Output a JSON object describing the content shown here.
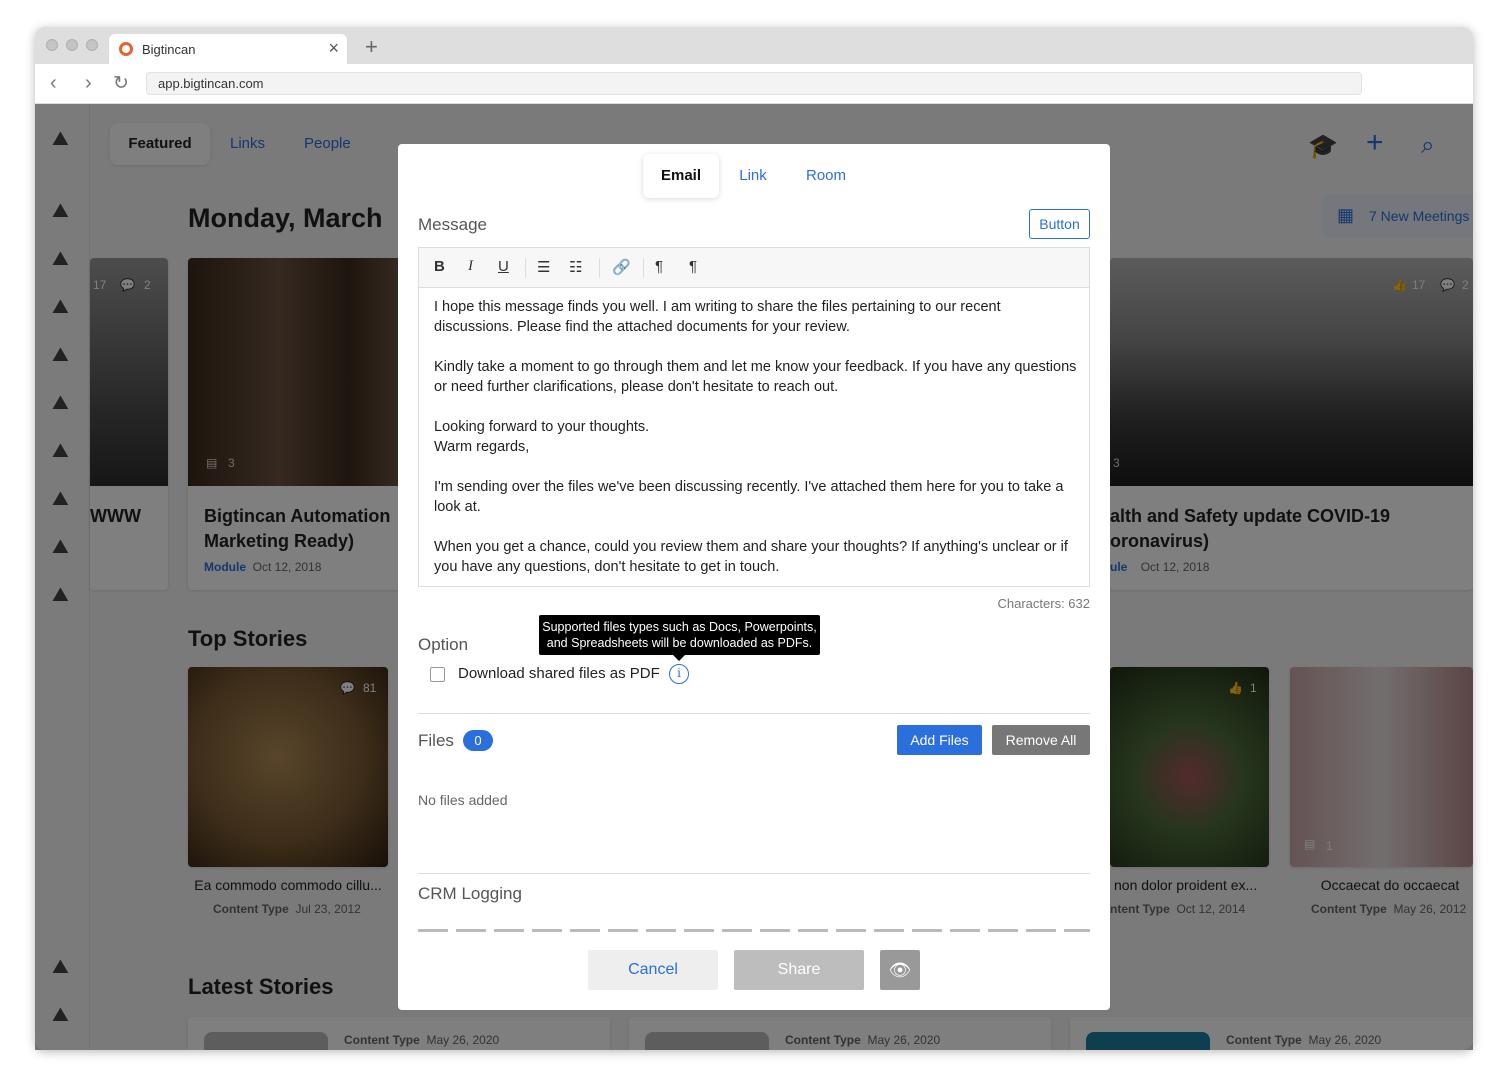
{
  "browser": {
    "tab_title": "Bigtincan",
    "url": "app.bigtincan.com",
    "new_tab": "+",
    "close": "×"
  },
  "app": {
    "nav": {
      "featured": "Featured",
      "links": "Links",
      "people": "People"
    },
    "date_heading": "Monday, March",
    "meetings": "7 New Meetings",
    "cards": {
      "left_partial": {
        "title": "WWW",
        "likes": "17",
        "comments": "2"
      },
      "automation": {
        "title_line1": "Bigtincan Automation",
        "title_line2": "Marketing Ready)",
        "type": "Module",
        "date": "Oct 12, 2018",
        "files": "3"
      },
      "covid": {
        "title_line1": "alth and Safety update COVID-19",
        "title_line2": "oronavirus)",
        "type": "ule",
        "date": "Oct 12, 2018",
        "likes": "17",
        "comments": "2",
        "files": "3"
      }
    },
    "top_stories": {
      "heading": "Top Stories",
      "items": [
        {
          "title": "Ea commodo commodo cillu...",
          "type": "Content Type",
          "date": "Jul 23, 2012",
          "comments": "81"
        },
        {
          "title": "non dolor proident ex...",
          "type": "ntent Type",
          "date": "Oct 12, 2014",
          "likes": "1"
        },
        {
          "title": "Occaecat do occaecat",
          "type": "Content Type",
          "date": "May 26, 2012",
          "files": "1"
        }
      ]
    },
    "latest_stories": {
      "heading": "Latest Stories",
      "items": [
        {
          "type": "Content Type",
          "date": "May 26, 2020"
        },
        {
          "type": "Content Type",
          "date": "May 26, 2020"
        },
        {
          "type": "Content Type",
          "date": "May 26, 2020"
        }
      ]
    }
  },
  "modal": {
    "tabs": {
      "email": "Email",
      "link": "Link",
      "room": "Room"
    },
    "message_label": "Message",
    "button_label": "Button",
    "toolbar": {
      "bold": "B",
      "italic": "I",
      "underline": "U"
    },
    "body": {
      "p1": "I hope this message finds you well. I am writing to share the files pertaining to our recent discussions. Please find the attached documents for your review.",
      "p2": "Kindly take a moment to go through them and let me know your feedback. If you have any questions or need further clarifications, please don't hesitate to reach out.",
      "p3a": "Looking forward to your thoughts.",
      "p3b": "Warm regards,",
      "p4": "I'm sending over the files we've been discussing recently. I've attached them here for you to take a look at.",
      "p5": "When you get a chance, could you review them and share your thoughts? If anything's unclear or if you have any questions, don't hesitate to get in touch."
    },
    "characters": "Characters: 632",
    "option_label": "Option",
    "tooltip": "Supported files types such as Docs, Powerpoints, and Spreadsheets will be downloaded as PDFs.",
    "pdf_checkbox": "Download shared files as PDF",
    "files_label": "Files",
    "files_count": "0",
    "add_files": "Add Files",
    "remove_all": "Remove All",
    "no_files": "No files added",
    "crm_label": "CRM Logging",
    "cancel": "Cancel",
    "share": "Share"
  }
}
